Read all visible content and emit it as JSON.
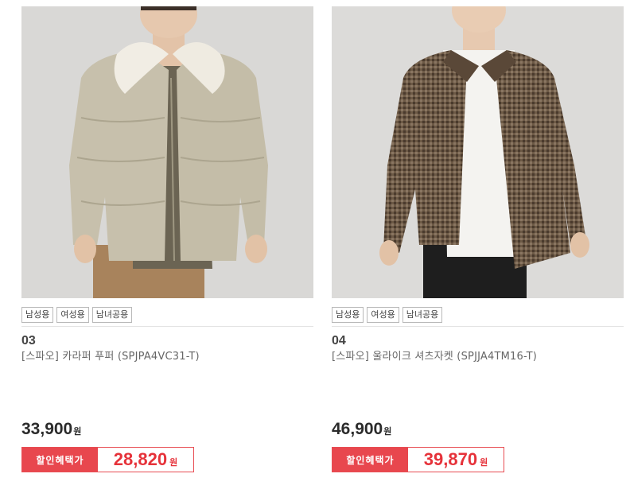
{
  "products": [
    {
      "tags": [
        "남성용",
        "여성용",
        "남녀공용"
      ],
      "number": "03",
      "name": "[스파오] 카라퍼 푸퍼 (SPJPA4VC31-T)",
      "price": "33,900",
      "currency": "원",
      "sale_label": "할인혜택가",
      "sale_price": "28,820",
      "image": "man-wearing-beige-puffer-jacket-with-fleece-collar"
    },
    {
      "tags": [
        "남성용",
        "여성용",
        "남녀공용"
      ],
      "number": "04",
      "name": "[스파오] 울라이크 셔츠자켓 (SPJJA4TM16-T)",
      "price": "46,900",
      "currency": "원",
      "sale_label": "할인혜택가",
      "sale_price": "39,870",
      "image": "man-wearing-brown-check-shirt-jacket"
    }
  ],
  "colors": {
    "sale_accent": "#e8474e",
    "sale_price_text": "#e6323a",
    "price_text": "#2b2b2b"
  }
}
